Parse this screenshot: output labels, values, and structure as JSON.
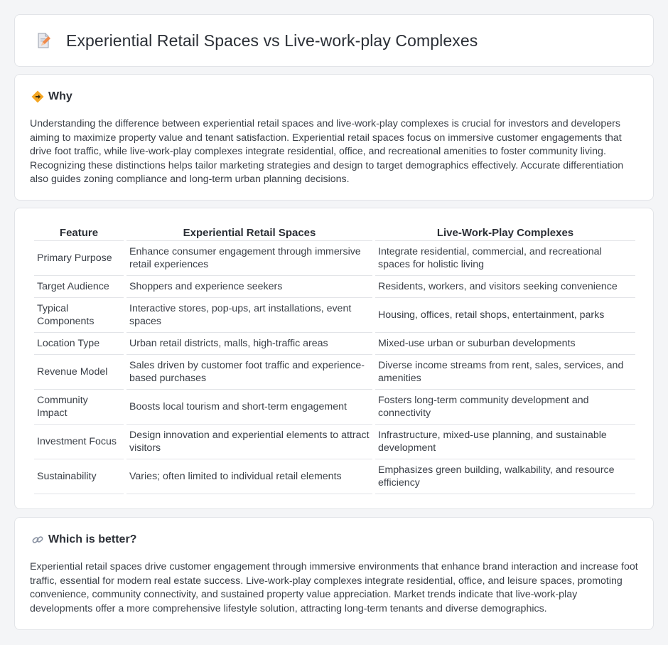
{
  "header": {
    "title": "Experiential Retail Spaces vs Live-work-play Complexes",
    "icon": "document-pencil-icon"
  },
  "why": {
    "heading": "Why",
    "icon": "diamond-arrow-icon",
    "text": "Understanding the difference between experiential retail spaces and live-work-play complexes is crucial for investors and developers aiming to maximize property value and tenant satisfaction. Experiential retail spaces focus on immersive customer engagements that drive foot traffic, while live-work-play complexes integrate residential, office, and recreational amenities to foster community living. Recognizing these distinctions helps tailor marketing strategies and design to target demographics effectively. Accurate differentiation also guides zoning compliance and long-term urban planning decisions."
  },
  "table": {
    "headers": [
      "Feature",
      "Experiential Retail Spaces",
      "Live-Work-Play Complexes"
    ],
    "rows": [
      [
        "Primary Purpose",
        "Enhance consumer engagement through immersive retail experiences",
        "Integrate residential, commercial, and recreational spaces for holistic living"
      ],
      [
        "Target Audience",
        "Shoppers and experience seekers",
        "Residents, workers, and visitors seeking convenience"
      ],
      [
        "Typical Components",
        "Interactive stores, pop-ups, art installations, event spaces",
        "Housing, offices, retail shops, entertainment, parks"
      ],
      [
        "Location Type",
        "Urban retail districts, malls, high-traffic areas",
        "Mixed-use urban or suburban developments"
      ],
      [
        "Revenue Model",
        "Sales driven by customer foot traffic and experience-based purchases",
        "Diverse income streams from rent, sales, services, and amenities"
      ],
      [
        "Community Impact",
        "Boosts local tourism and short-term engagement",
        "Fosters long-term community development and connectivity"
      ],
      [
        "Investment Focus",
        "Design innovation and experiential elements to attract visitors",
        "Infrastructure, mixed-use planning, and sustainable development"
      ],
      [
        "Sustainability",
        "Varies; often limited to individual retail elements",
        "Emphasizes green building, walkability, and resource efficiency"
      ]
    ]
  },
  "better": {
    "heading": "Which is better?",
    "icon": "link-icon",
    "text": "Experiential retail spaces drive customer engagement through immersive environments that enhance brand interaction and increase foot traffic, essential for modern real estate success. Live-work-play complexes integrate residential, office, and leisure spaces, promoting convenience, community connectivity, and sustained property value appreciation. Market trends indicate that live-work-play developments offer a more comprehensive lifestyle solution, attracting long-term tenants and diverse demographics."
  }
}
